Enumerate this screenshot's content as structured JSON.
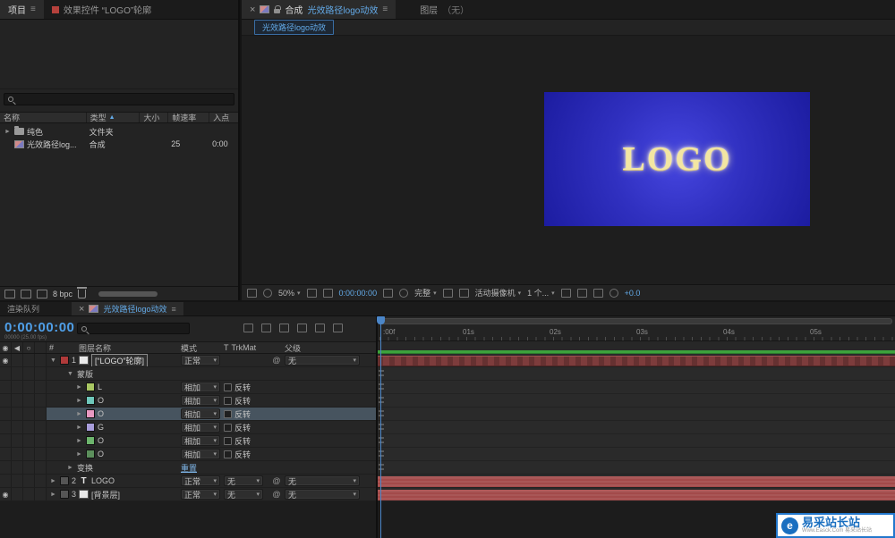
{
  "icons": {
    "menu": "≡",
    "close": "×",
    "sort_up": "▲",
    "twirl_open": "▼",
    "twirl_closed": "►",
    "dd_arrow": "▾",
    "at": "@",
    "eye": "◉",
    "speaker": "◀",
    "solo": "○"
  },
  "project": {
    "tab_project": "项目",
    "tab_effects": "效果控件 “LOGO”轮廓",
    "columns": {
      "name": "名称",
      "type": "类型",
      "size": "大小",
      "fps": "帧速率",
      "in": "入点"
    },
    "rows": [
      {
        "name": "纯色",
        "type": "文件夹",
        "fps": "",
        "in": ""
      },
      {
        "name": "光效路径log...",
        "type": "合成",
        "fps": "25",
        "in": "0:00"
      }
    ],
    "bpc": "8 bpc"
  },
  "comp": {
    "tab_label": "合成",
    "tab_name": "光效路径logo动效",
    "layer_tab": "图层",
    "layer_tab_state": "（无）",
    "subtab": "光效路径logo动效",
    "logo": "LOGO",
    "toolbar": {
      "zoom": "50%",
      "time": "0:00:00:00",
      "resolution": "完整",
      "camera": "活动摄像机",
      "views": "1 个...",
      "exposure": "+0.0"
    }
  },
  "timeline": {
    "tab_render_queue": "渲染队列",
    "tab_comp": "光效路径logo动效",
    "time": "0:00:00:00",
    "time_sub": "00000 (25.00 fps)",
    "columns": {
      "num": "#",
      "layer_name": "图层名称",
      "mode": "模式",
      "t": "T",
      "trkmat": "TrkMat",
      "parent": "父级"
    },
    "none": "无",
    "mode_normal": "正常",
    "layer1": {
      "num": "1",
      "name": "[“LOGO”轮廓]"
    },
    "masks_label": "蒙版",
    "mask_mode": "相加",
    "invert_label": "反转",
    "masks": [
      {
        "letter": "L",
        "chip": "background:#a9c763"
      },
      {
        "letter": "O",
        "chip": "background:#6fc8bb"
      },
      {
        "letter": "O",
        "chip": "background:#e899c2"
      },
      {
        "letter": "G",
        "chip": "background:#a89ddb"
      },
      {
        "letter": "O",
        "chip": "background:#6db56d"
      },
      {
        "letter": "O",
        "chip": "background:#5c8f5c"
      }
    ],
    "transform_label": "变换",
    "reset_label": "重置",
    "layer2": {
      "num": "2",
      "t": "T",
      "name": "LOGO"
    },
    "layer3": {
      "num": "3",
      "name": "[背景层]"
    },
    "ruler": [
      ":00f",
      "01s",
      "02s",
      "03s",
      "04s",
      "05s"
    ]
  },
  "watermark": {
    "logo_letter": "e",
    "title": "易采站长站",
    "subtitle": "Www.Easck.Com 易采站长站"
  }
}
